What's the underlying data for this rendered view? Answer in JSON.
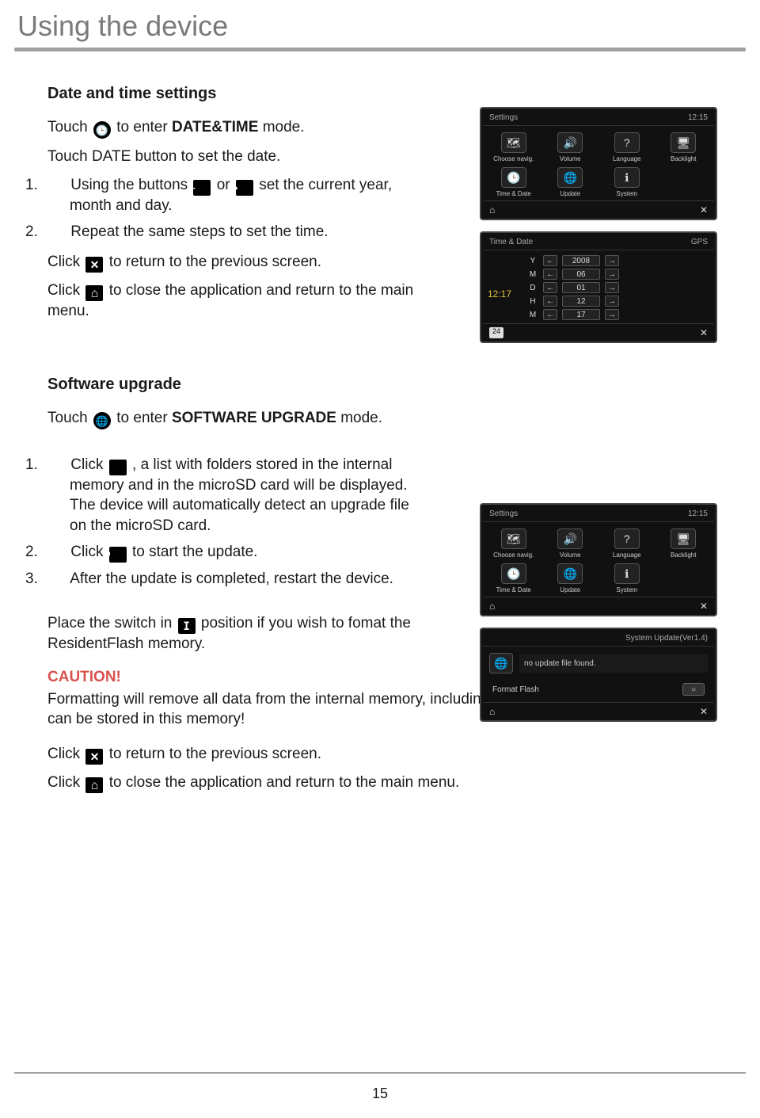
{
  "page": {
    "title": "Using the device",
    "number": "15"
  },
  "datetime": {
    "heading": "Date and time settings",
    "touch_pre": "Touch ",
    "touch_post": " to enter ",
    "mode_label": "DATE&TIME",
    "mode_suffix": " mode.",
    "touch_date": "Touch DATE button to set the date.",
    "steps": {
      "s1_pre": "Using the buttons ",
      "s1_mid": " or ",
      "s1_post": " set the current year, month and day.",
      "s2": "Repeat the same steps to set the time."
    },
    "click_x_pre": "Click ",
    "click_x_post": " to return to the previous screen.",
    "click_home_pre": "Click ",
    "click_home_post": " to close the application and return to the main menu."
  },
  "software": {
    "heading": "Software upgrade",
    "touch_pre": "Touch ",
    "touch_post": " to enter ",
    "mode_label": "SOFTWARE UPGRADE",
    "mode_suffix": " mode.",
    "steps": {
      "s1_pre": "Click ",
      "s1_post": ", a list with folders stored in the internal memory and in the microSD card will be displayed. The device will automatically detect an upgrade file on the microSD card.",
      "s2_pre": "Click ",
      "s2_post": " to start the update.",
      "s3": "After the update is completed, restart the device."
    },
    "switch_pre": "Place the switch in ",
    "switch_post": " position if you wish to fomat the ResidentFlash memory.",
    "caution_label": "CAUTION!",
    "caution_body": "Formatting will remove all data from the internal memory, including any map application that can be stored in this memory!",
    "click_x_pre": "Click ",
    "click_x_post": " to return to the previous screen.",
    "click_home_pre": "Click ",
    "click_home_post": " to close the application and return to the main menu."
  },
  "screens": {
    "settings_title": "Settings",
    "time_hint": "12:15",
    "icons": [
      {
        "glyph": "🗺",
        "label": "Choose navig."
      },
      {
        "glyph": "🔊",
        "label": "Volume"
      },
      {
        "glyph": "?",
        "label": "Language"
      },
      {
        "glyph": "🖥",
        "label": "Backlight"
      },
      {
        "glyph": "🕒",
        "label": "Time & Date"
      },
      {
        "glyph": "🌐",
        "label": "Update"
      },
      {
        "glyph": "ℹ",
        "label": "System"
      }
    ],
    "td_title": "Time & Date",
    "td_gps": "GPS",
    "td_time": "12:17",
    "td_rows": [
      {
        "k": "Y",
        "v": "2008"
      },
      {
        "k": "M",
        "v": "06"
      },
      {
        "k": "D",
        "v": "01"
      },
      {
        "k": "H",
        "v": "12"
      },
      {
        "k": "M",
        "v": "17"
      }
    ],
    "td_tick": "24",
    "su_title": "System Update(Ver1.4)",
    "su_msg": "no update file found.",
    "su_format": "Format Flash"
  }
}
